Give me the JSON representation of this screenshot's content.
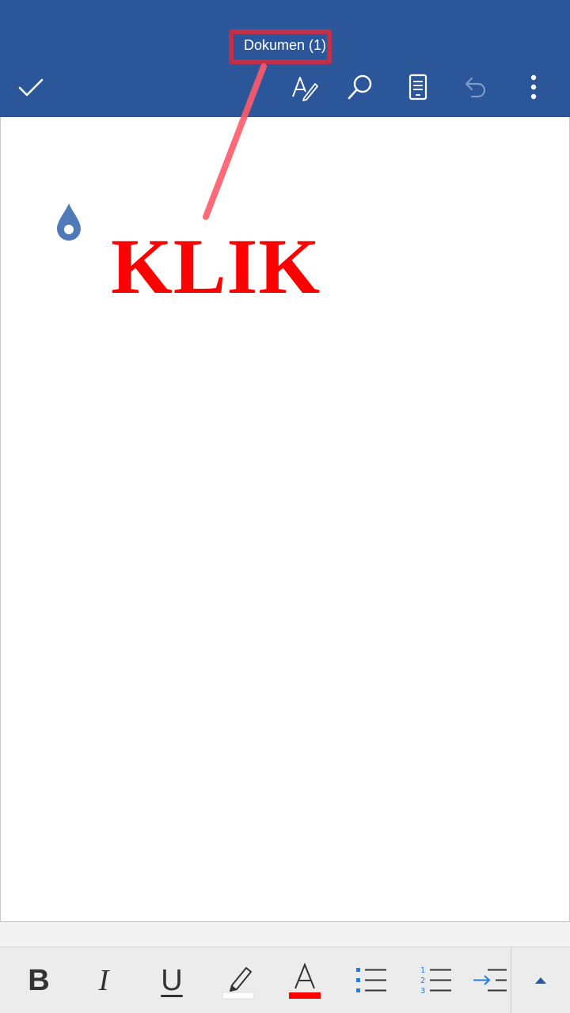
{
  "app_bar": {
    "document_title": "Dokumen (1)",
    "background_color": "#2b579a",
    "actions": [
      {
        "name": "done",
        "icon": "checkmark-icon"
      },
      {
        "name": "draw",
        "icon": "pen-draw-icon"
      },
      {
        "name": "find",
        "icon": "search-icon"
      },
      {
        "name": "mobile-view",
        "icon": "mobile-view-icon"
      },
      {
        "name": "undo",
        "icon": "undo-icon",
        "enabled": false
      },
      {
        "name": "more-options",
        "icon": "more-vertical-icon"
      }
    ]
  },
  "annotation": {
    "text": "KLIK",
    "color": "#ff0000",
    "highlight_color": "#c0304a"
  },
  "document": {
    "body_text": "",
    "cursor_handle_color": "#5079b8"
  },
  "format_toolbar": {
    "bold_label": "B",
    "italic_label": "I",
    "underline_label": "U",
    "font_color_label": "A",
    "font_color": "#ff0000",
    "highlight_color": "#ffffff",
    "tools": [
      "bold",
      "italic",
      "underline",
      "highlight",
      "font-color",
      "bullets",
      "numbering",
      "indent",
      "expand"
    ]
  }
}
